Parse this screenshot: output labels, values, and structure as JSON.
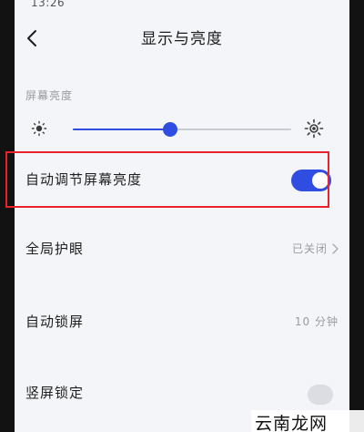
{
  "status_bar": {
    "time": "13:26"
  },
  "header": {
    "title": "显示与亮度",
    "back_icon": "back-chevron-icon"
  },
  "brightness": {
    "section_label": "屏幕亮度",
    "level_fraction": 0.445,
    "low_icon": "sun-low-icon",
    "high_icon": "sun-high-icon",
    "accent_color": "#2f4de0"
  },
  "settings": [
    {
      "label": "自动调节屏幕亮度",
      "toggle": "on"
    },
    {
      "label": "全局护眼",
      "value": "已关闭"
    },
    {
      "label": "自动锁屏",
      "value": "10 分钟"
    },
    {
      "label": "竖屏锁定"
    }
  ],
  "watermark": {
    "text": "云南龙网"
  },
  "colors": {
    "accent": "#2f4de0",
    "highlight_border": "#e8242a",
    "background": "#f4f5f8"
  }
}
